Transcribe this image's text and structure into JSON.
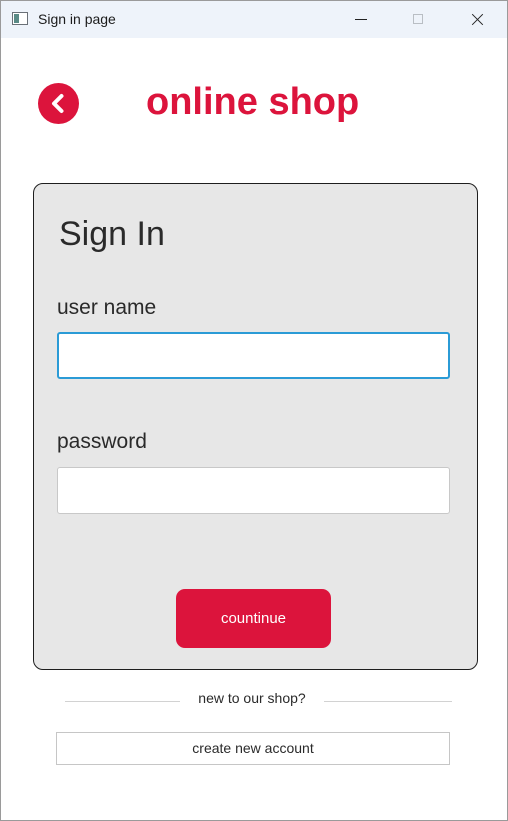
{
  "window": {
    "title": "Sign in page"
  },
  "header": {
    "back_icon": "chevron-left-icon",
    "shop_name": "online shop"
  },
  "signin": {
    "title": "Sign In",
    "username_label": "user name",
    "username_value": "",
    "password_label": "password",
    "password_value": "",
    "continue_label": "countinue"
  },
  "footer": {
    "divider_text": "new to our shop?",
    "create_account_label": "create new account"
  },
  "colors": {
    "accent": "#dc143c",
    "card_bg": "#e7e7e7",
    "focus_border": "#2b9bd6"
  }
}
